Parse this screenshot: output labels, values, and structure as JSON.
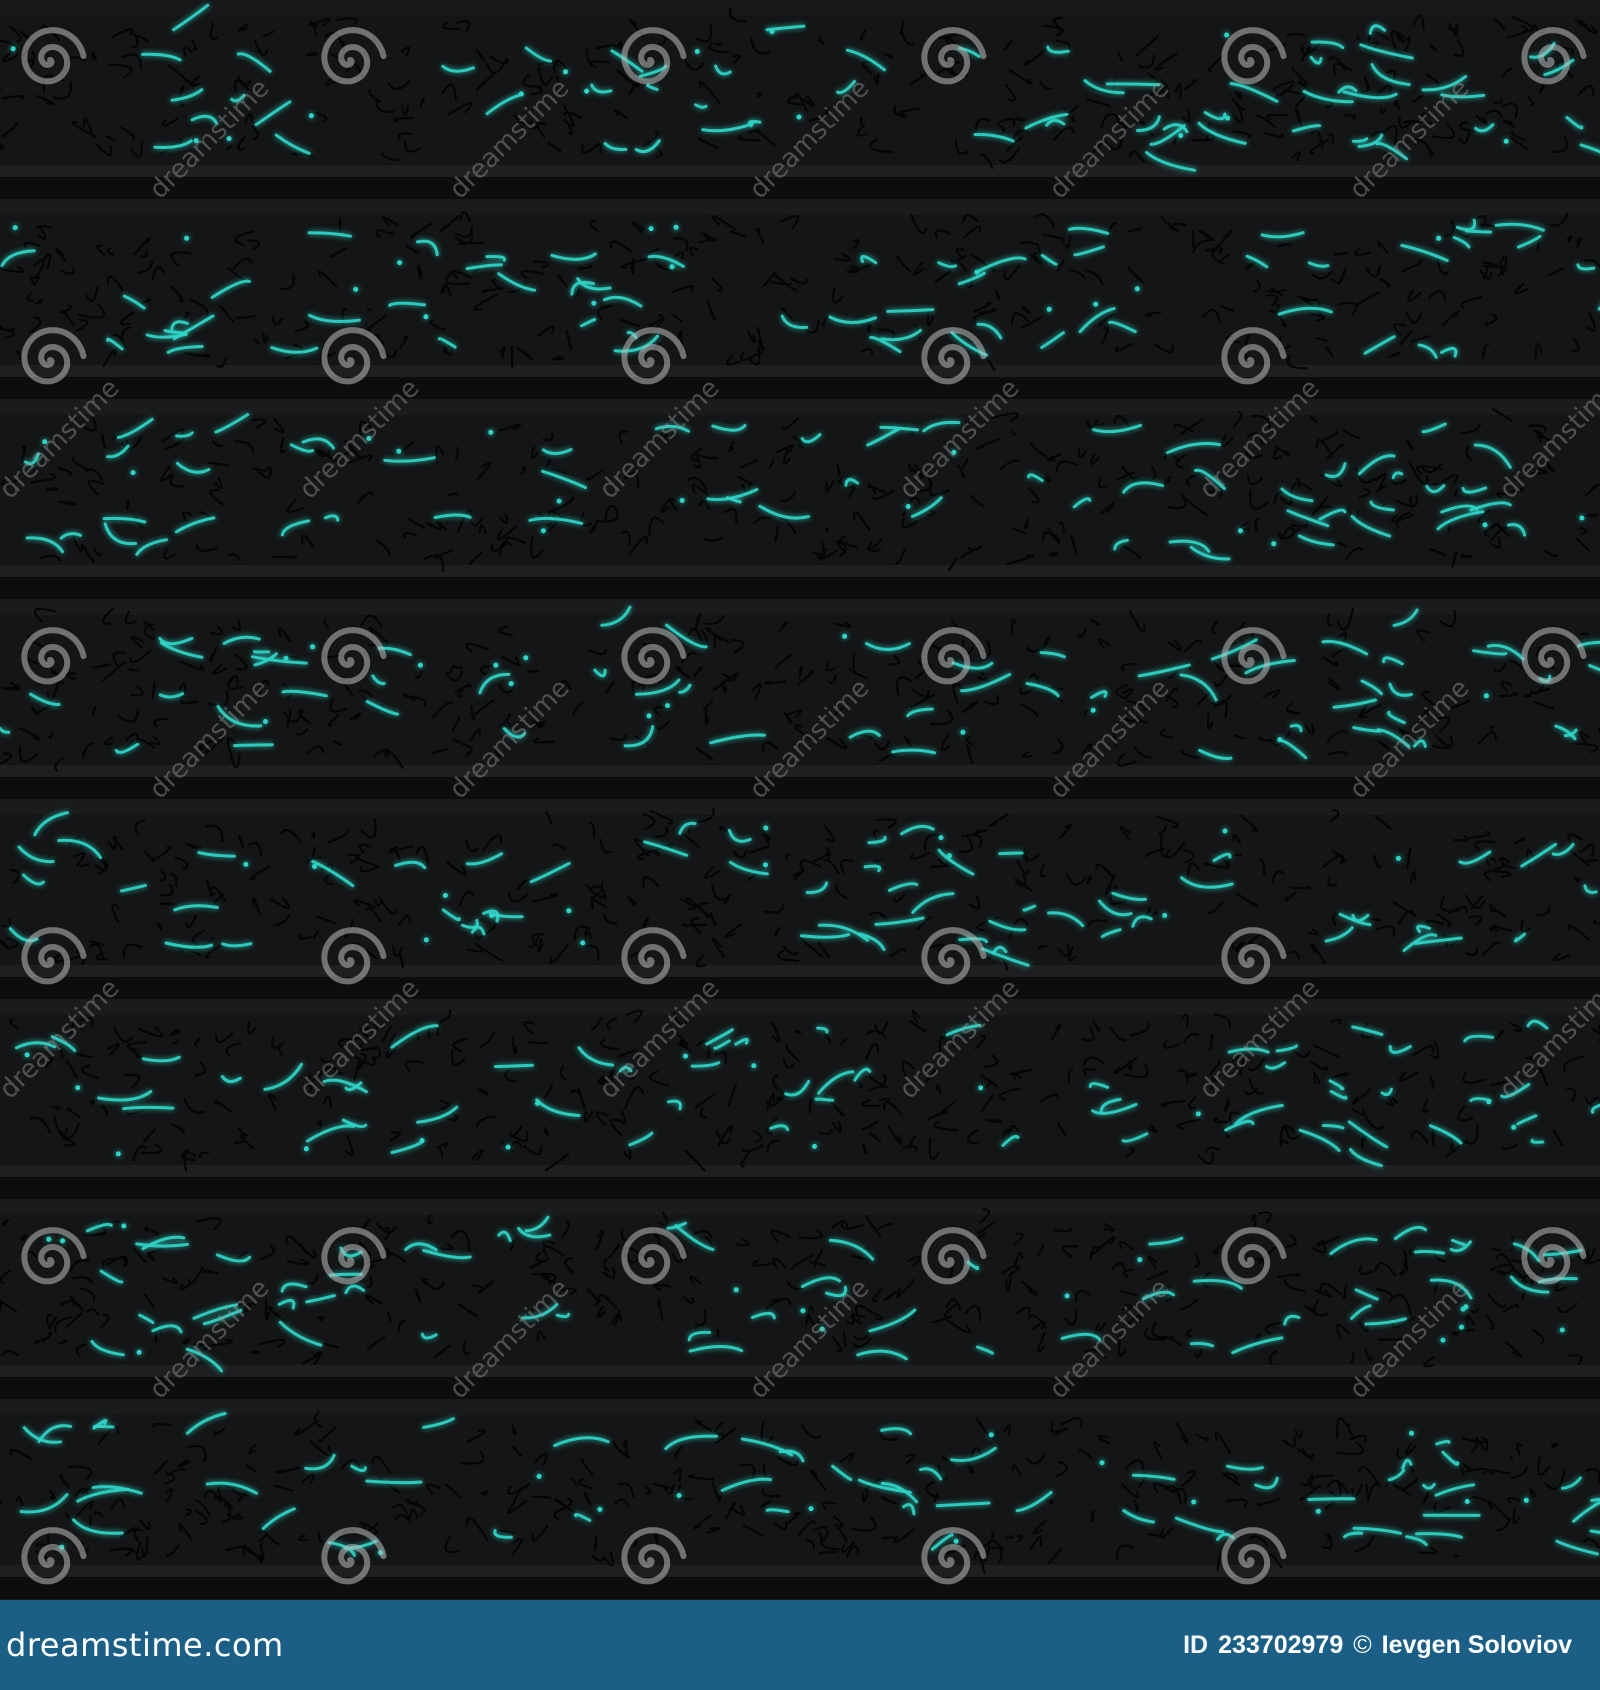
{
  "image": {
    "description_colors": {
      "background": "#161718",
      "band_dark": "#0c0d0e",
      "band_mid": "#1e1f21",
      "accent": "#2fd6c8",
      "scribble": "#050505",
      "footer": "#1b5f86"
    }
  },
  "watermark": {
    "text": "dreamstime",
    "icon": "spiral-logo-icon"
  },
  "footer": {
    "brand": "dreamstime.com",
    "id_label": "ID",
    "id_value": "233702979",
    "copyright_symbol": "©",
    "author": "Ievgen Soloviov"
  }
}
